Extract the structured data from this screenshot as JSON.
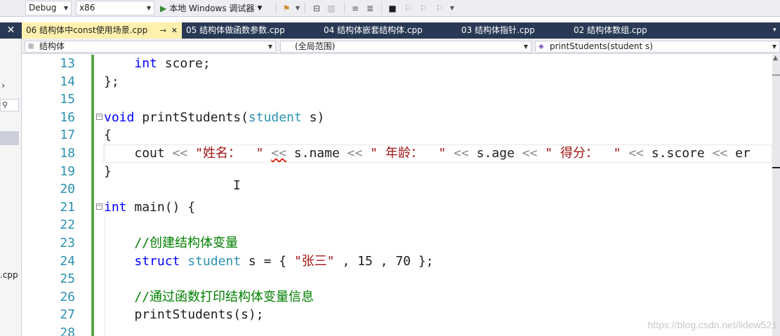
{
  "toolbar": {
    "config": "Debug",
    "platform": "x86",
    "run_label": "本地 Windows 调试器",
    "run_dropdown": "▾"
  },
  "tabs": [
    {
      "label": "06 结构体中const使用场景.cpp",
      "active": true
    },
    {
      "label": "05 结构体做函数参数.cpp",
      "active": false
    },
    {
      "label": "04 结构体嵌套结构体.cpp",
      "active": false
    },
    {
      "label": "03 结构体指针.cpp",
      "active": false
    },
    {
      "label": "02 结构体数组.cpp",
      "active": false
    }
  ],
  "navbar": {
    "scope_type": "结构体",
    "scope_global": "(全局范围)",
    "member": "printStudents(student s)"
  },
  "leftstrip": {
    "file_suffix": ".cpp"
  },
  "editor": {
    "line_numbers": [
      "13",
      "14",
      "15",
      "16",
      "17",
      "18",
      "19",
      "20",
      "21",
      "22",
      "23",
      "24",
      "25",
      "26",
      "27",
      "28"
    ],
    "lines": {
      "l13": {
        "kw": "int",
        "rest": " score;"
      },
      "l14": "};",
      "l16": {
        "kw": "void",
        "name": " printStudents(",
        "ty": "student",
        "rest": " s)"
      },
      "l17": "{",
      "l18": {
        "p1": "cout ",
        "p2": "<<",
        "s1": " \"姓名：  \"",
        "p3": " ",
        "p4": "<<",
        "p5": " s.name ",
        "p6": "<<",
        "s2": " \" 年龄：  \"",
        "p7": " ",
        "p8": "<<",
        "p9": " s.age ",
        "p10": "<<",
        "s3": " \" 得分：  \"",
        "p11": " ",
        "p12": "<<",
        "p13": " s.score ",
        "p14": "<<",
        "p15": " er"
      },
      "l19": "}",
      "l21": {
        "kw": "int",
        "rest": " main() {"
      },
      "l23": "//创建结构体变量",
      "l24": {
        "kw": "struct",
        "ty": " student",
        "rest1": " s = { ",
        "str": "\"张三\"",
        "rest2": " , 15 , 70 };"
      },
      "l26": "//通过函数打印结构体变量信息",
      "l27": "printStudents(s);"
    }
  },
  "watermark": "https://blog.csdn.net/lidew521"
}
